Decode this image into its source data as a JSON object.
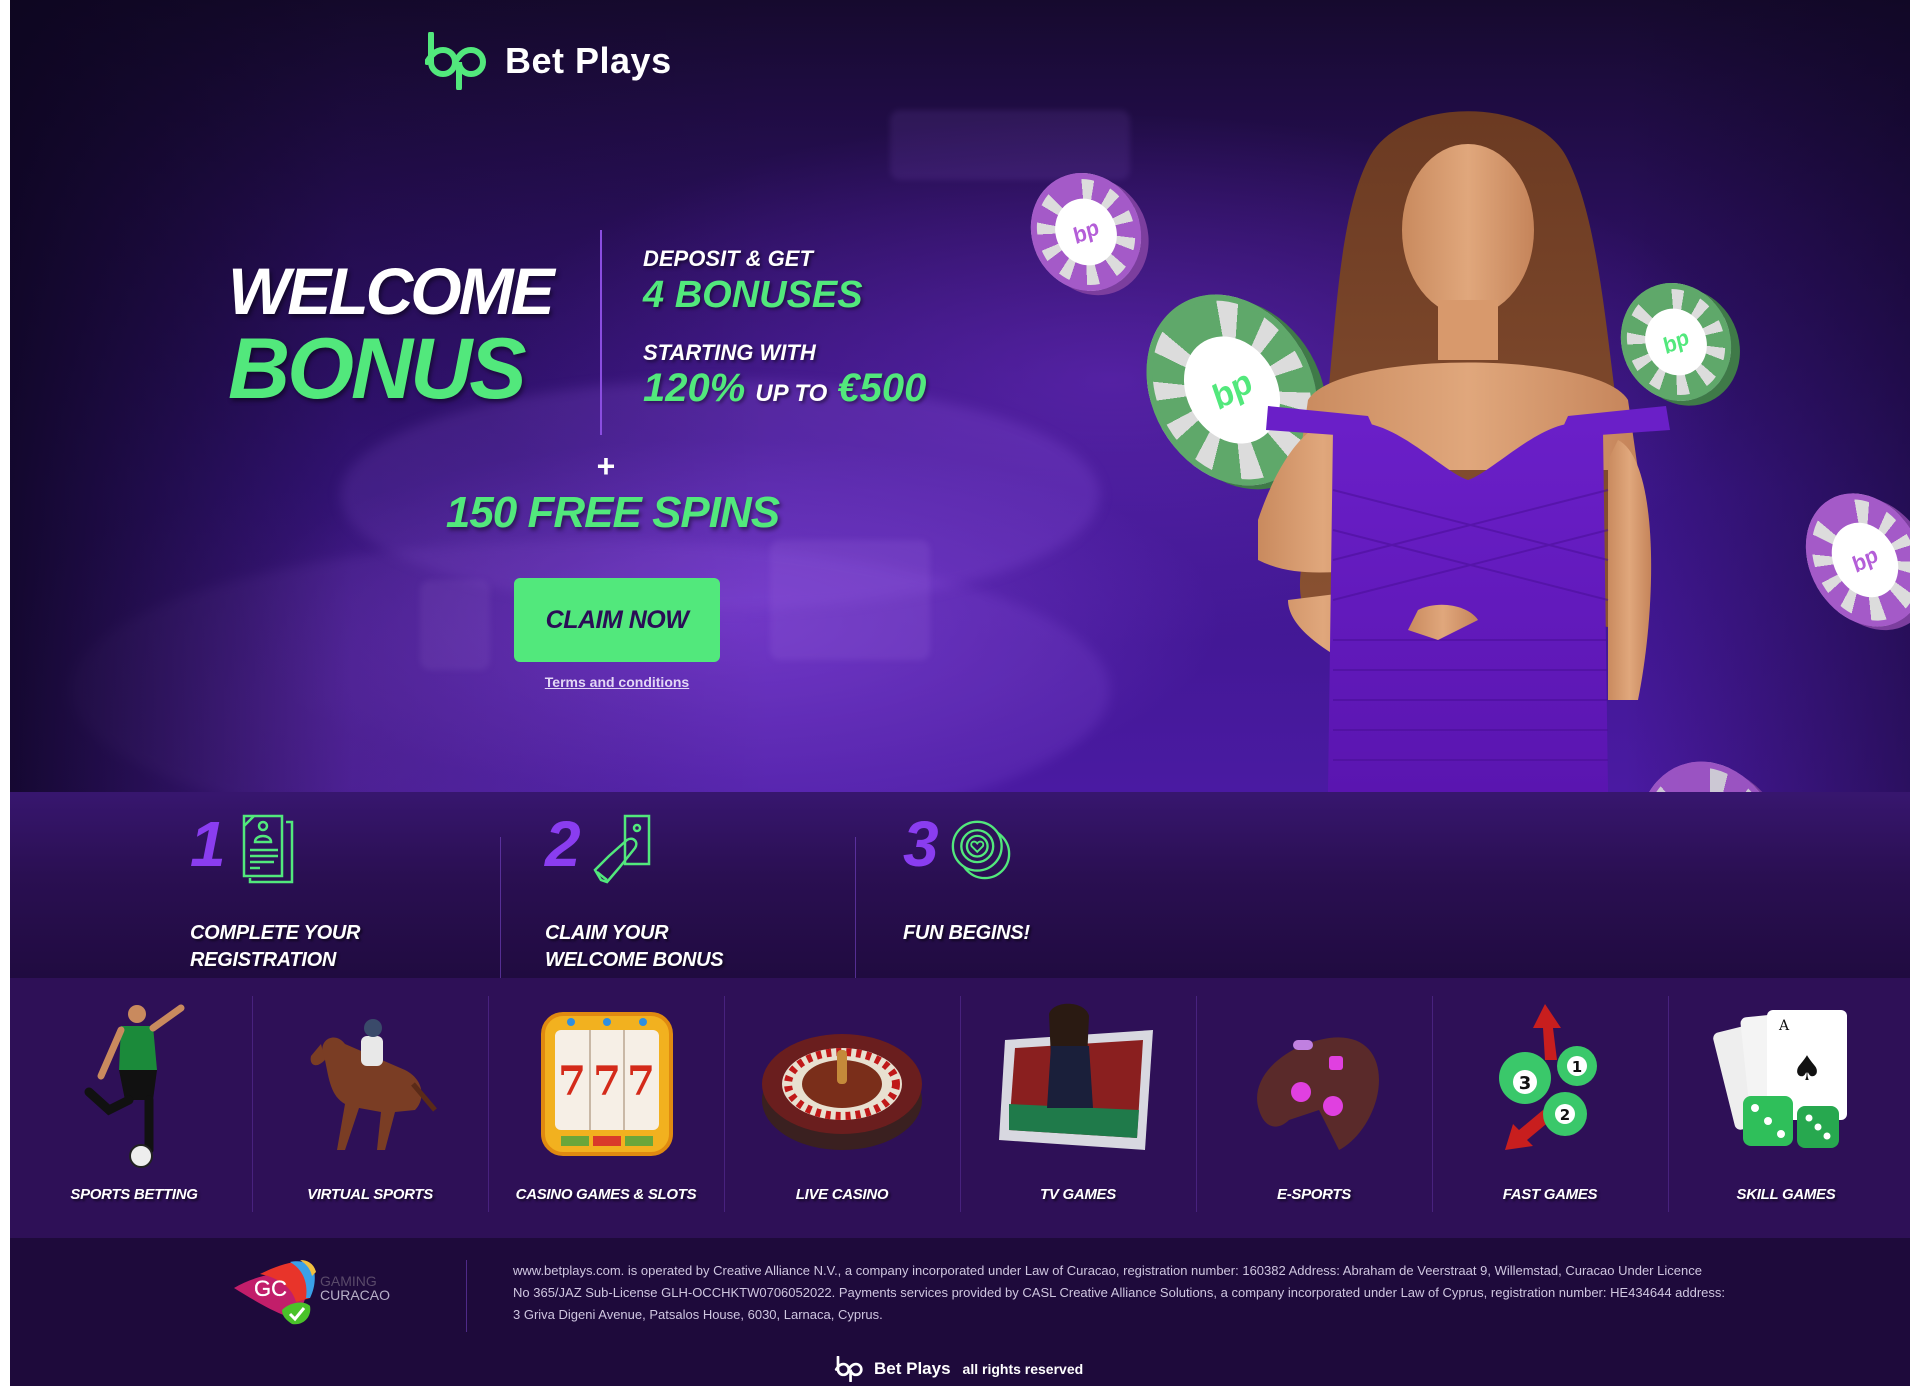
{
  "brand": {
    "name": "Bet Plays",
    "accent_color": "#52e87c",
    "purple_color": "#8a3df0"
  },
  "hero": {
    "headline_line1": "WELCOME",
    "headline_line2": "BONUS",
    "offer": {
      "line1": "DEPOSIT & GET",
      "line2": "4 BONUSES",
      "line3": "STARTING WITH",
      "percent": "120%",
      "up_to": "UP TO",
      "amount": "€500"
    },
    "plus": "+",
    "free_spins": "150 FREE SPINS",
    "cta_label": "CLAIM NOW",
    "terms_link": "Terms and conditions",
    "chip_logo_glyph": "bp"
  },
  "steps": [
    {
      "number": "1",
      "icon": "registration-document-icon",
      "label_line1": "COMPLETE YOUR",
      "label_line2": "REGISTRATION"
    },
    {
      "number": "2",
      "icon": "hand-holding-cash-icon",
      "label_line1": "CLAIM YOUR",
      "label_line2": "WELCOME BONUS"
    },
    {
      "number": "3",
      "icon": "casino-chips-icon",
      "label_line1": "FUN BEGINS!",
      "label_line2": ""
    }
  ],
  "categories": [
    {
      "label": "SPORTS BETTING",
      "icon": "soccer-player-icon"
    },
    {
      "label": "VIRTUAL SPORTS",
      "icon": "racehorse-jockey-icon"
    },
    {
      "label": "CASINO GAMES & SLOTS",
      "icon": "slot-machine-777-icon"
    },
    {
      "label": "LIVE CASINO",
      "icon": "roulette-wheel-icon"
    },
    {
      "label": "TV GAMES",
      "icon": "tv-dealer-tablet-icon"
    },
    {
      "label": "E-SPORTS",
      "icon": "gamepad-icon"
    },
    {
      "label": "FAST GAMES",
      "icon": "lottery-balls-icon"
    },
    {
      "label": "SKILL GAMES",
      "icon": "cards-and-dice-icon"
    }
  ],
  "footer": {
    "license_logo": {
      "gc": "GC",
      "line1": "GAMING",
      "line2": "CURACAO"
    },
    "legal_lines": [
      "www.betplays.com. is operated by Creative Alliance N.V., a company incorporated under Law of Curacao, registration number: 160382 Address: Abraham de Veerstraat 9, Willemstad, Curacao Under Licence",
      "No 365/JAZ Sub-License GLH-OCCHKTW0706052022. Payments services provided by CASL Creative Alliance Solutions, a company incorporated under Law of Cyprus, registration number: HE434644 address:",
      "3 Griva Digeni Avenue, Patsalos House, 6030, Larnaca, Cyprus."
    ],
    "brand_name": "Bet Plays",
    "rights": "all rights reserved"
  }
}
